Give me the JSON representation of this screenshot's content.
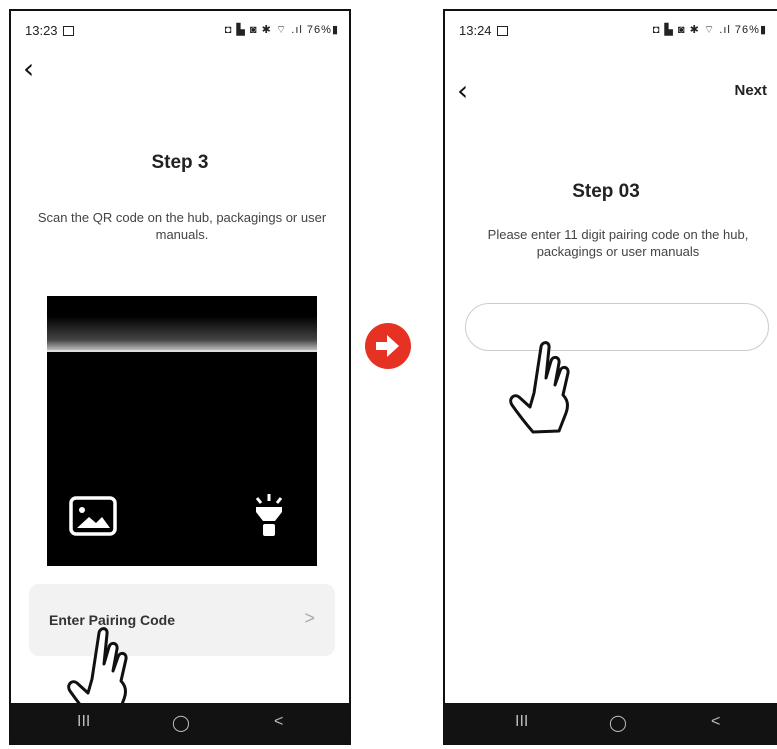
{
  "left": {
    "status": {
      "time": "13:23",
      "icons": "◘ ▙ ◙ ✱ ⌔ .ıl",
      "battery": "76%"
    },
    "title": "Step 3",
    "description": "Scan the QR code on the hub, packagings or user manuals.",
    "pair_row": {
      "label": "Enter Pairing Code",
      "chevron": ">"
    },
    "navbar": {
      "recents": "III",
      "home": "◯",
      "back": "<"
    }
  },
  "right": {
    "status": {
      "time": "13:24",
      "icons": "◘ ▙ ◙ ✱ ⌔ .ıl",
      "battery": "76%"
    },
    "next_label": "Next",
    "title": "Step 03",
    "description": "Please enter 11 digit pairing code on the hub, packagings or user manuals",
    "code_input": {
      "value": "",
      "placeholder": ""
    },
    "navbar": {
      "recents": "III",
      "home": "◯",
      "back": "<"
    }
  },
  "icons": {
    "back": "chevron-left-icon",
    "gallery": "image-icon",
    "flashlight": "flashlight-icon",
    "transition": "arrow-right-circle-icon",
    "pointer": "hand-pointer-icon"
  },
  "colors": {
    "accent_arrow": "#e53222",
    "navbar": "#121212",
    "row_bg": "#f2f2f2"
  }
}
